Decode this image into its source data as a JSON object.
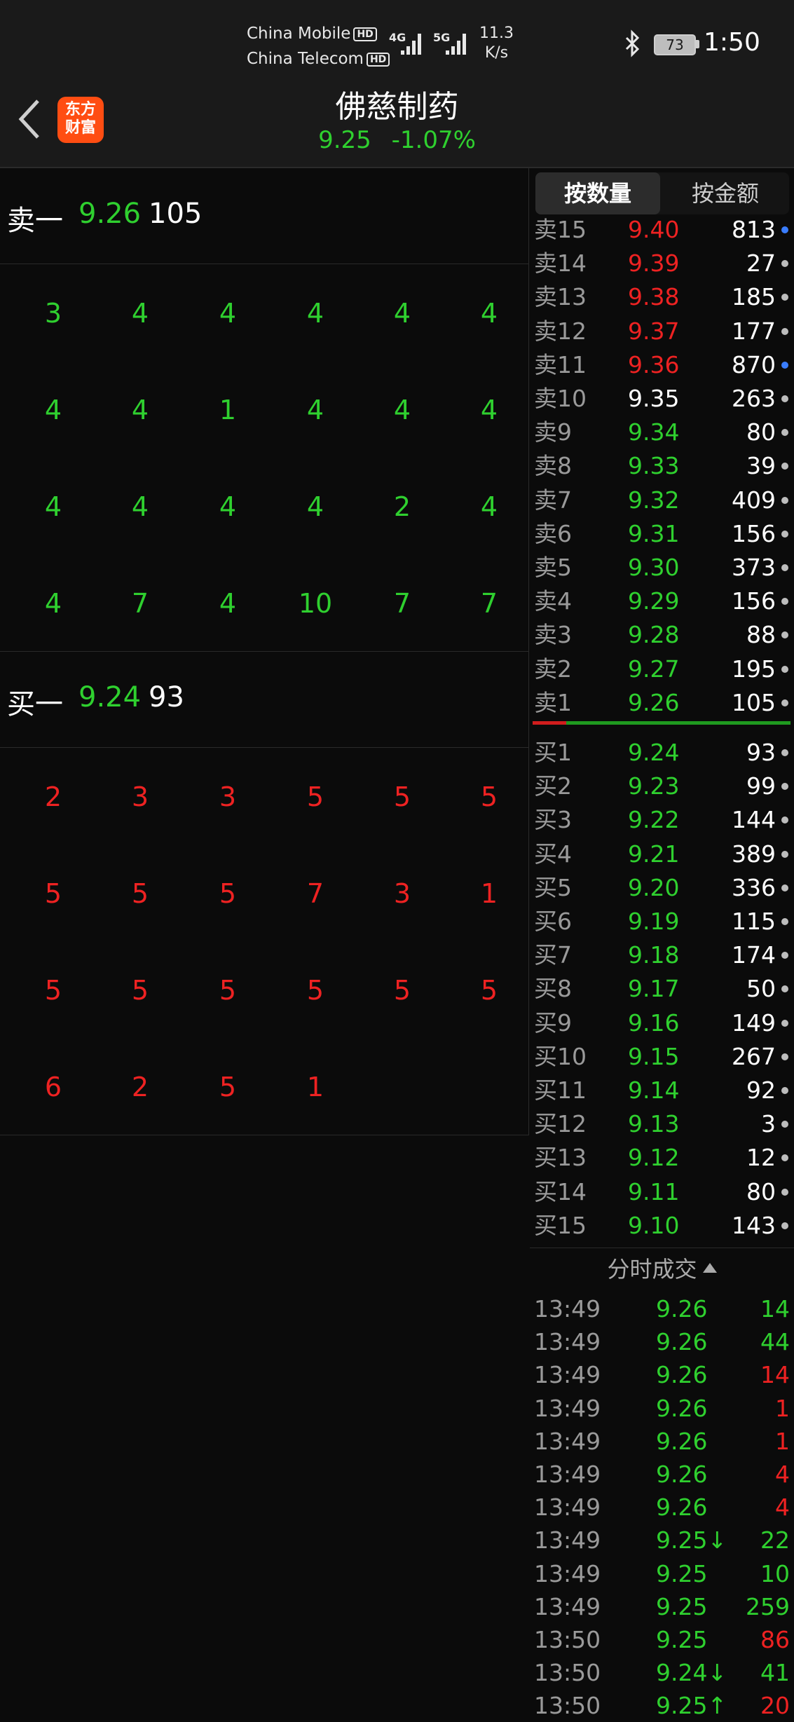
{
  "status_bar": {
    "carrier1": "China Mobile",
    "carrier2": "China Telecom",
    "hd_badge": "HD",
    "sig1_label": "4G",
    "sig2_label": "5G",
    "net_speed_value": "11.3",
    "net_speed_unit": "K/s",
    "battery": "73",
    "time": "1:50"
  },
  "header": {
    "logo_line1": "东方",
    "logo_line2": "财富",
    "stock_name": "佛慈制药",
    "price": "9.25",
    "change": "-1.07%"
  },
  "level1": {
    "sell_label": "卖一",
    "sell_price": "9.26",
    "sell_volume": "105",
    "buy_label": "买一",
    "buy_price": "9.24",
    "buy_volume": "93"
  },
  "sell_queue": [
    [
      "3",
      "4",
      "4",
      "4",
      "4",
      "4"
    ],
    [
      "4",
      "4",
      "1",
      "4",
      "4",
      "4"
    ],
    [
      "4",
      "4",
      "4",
      "4",
      "2",
      "4"
    ],
    [
      "4",
      "7",
      "4",
      "10",
      "7",
      "7"
    ]
  ],
  "buy_queue": [
    [
      "2",
      "3",
      "3",
      "5",
      "5",
      "5"
    ],
    [
      "5",
      "5",
      "5",
      "7",
      "3",
      "1"
    ],
    [
      "5",
      "5",
      "5",
      "5",
      "5",
      "5"
    ],
    [
      "6",
      "2",
      "5",
      "1",
      "",
      ""
    ]
  ],
  "tabs": {
    "by_volume": "按数量",
    "by_amount": "按金额"
  },
  "order_book": {
    "asks": [
      {
        "label": "卖15",
        "price": "9.40",
        "volume": "813",
        "color": "red",
        "dot": "blue"
      },
      {
        "label": "卖14",
        "price": "9.39",
        "volume": "27",
        "color": "red",
        "dot": "grey"
      },
      {
        "label": "卖13",
        "price": "9.38",
        "volume": "185",
        "color": "red",
        "dot": "grey"
      },
      {
        "label": "卖12",
        "price": "9.37",
        "volume": "177",
        "color": "red",
        "dot": "grey"
      },
      {
        "label": "卖11",
        "price": "9.36",
        "volume": "870",
        "color": "red",
        "dot": "blue"
      },
      {
        "label": "卖10",
        "price": "9.35",
        "volume": "263",
        "color": "white",
        "dot": "grey"
      },
      {
        "label": "卖9",
        "price": "9.34",
        "volume": "80",
        "color": "green",
        "dot": "grey"
      },
      {
        "label": "卖8",
        "price": "9.33",
        "volume": "39",
        "color": "green",
        "dot": "grey"
      },
      {
        "label": "卖7",
        "price": "9.32",
        "volume": "409",
        "color": "green",
        "dot": "grey"
      },
      {
        "label": "卖6",
        "price": "9.31",
        "volume": "156",
        "color": "green",
        "dot": "grey"
      },
      {
        "label": "卖5",
        "price": "9.30",
        "volume": "373",
        "color": "green",
        "dot": "grey"
      },
      {
        "label": "卖4",
        "price": "9.29",
        "volume": "156",
        "color": "green",
        "dot": "grey"
      },
      {
        "label": "卖3",
        "price": "9.28",
        "volume": "88",
        "color": "green",
        "dot": "grey"
      },
      {
        "label": "卖2",
        "price": "9.27",
        "volume": "195",
        "color": "green",
        "dot": "grey"
      },
      {
        "label": "卖1",
        "price": "9.26",
        "volume": "105",
        "color": "green",
        "dot": "grey"
      }
    ],
    "bids": [
      {
        "label": "买1",
        "price": "9.24",
        "volume": "93",
        "color": "green",
        "dot": "grey"
      },
      {
        "label": "买2",
        "price": "9.23",
        "volume": "99",
        "color": "green",
        "dot": "grey"
      },
      {
        "label": "买3",
        "price": "9.22",
        "volume": "144",
        "color": "green",
        "dot": "grey"
      },
      {
        "label": "买4",
        "price": "9.21",
        "volume": "389",
        "color": "green",
        "dot": "grey"
      },
      {
        "label": "买5",
        "price": "9.20",
        "volume": "336",
        "color": "green",
        "dot": "grey"
      },
      {
        "label": "买6",
        "price": "9.19",
        "volume": "115",
        "color": "green",
        "dot": "grey"
      },
      {
        "label": "买7",
        "price": "9.18",
        "volume": "174",
        "color": "green",
        "dot": "grey"
      },
      {
        "label": "买8",
        "price": "9.17",
        "volume": "50",
        "color": "green",
        "dot": "grey"
      },
      {
        "label": "买9",
        "price": "9.16",
        "volume": "149",
        "color": "green",
        "dot": "grey"
      },
      {
        "label": "买10",
        "price": "9.15",
        "volume": "267",
        "color": "green",
        "dot": "grey"
      },
      {
        "label": "买11",
        "price": "9.14",
        "volume": "92",
        "color": "green",
        "dot": "grey"
      },
      {
        "label": "买12",
        "price": "9.13",
        "volume": "3",
        "color": "green",
        "dot": "grey"
      },
      {
        "label": "买13",
        "price": "9.12",
        "volume": "12",
        "color": "green",
        "dot": "grey"
      },
      {
        "label": "买14",
        "price": "9.11",
        "volume": "80",
        "color": "green",
        "dot": "grey"
      },
      {
        "label": "买15",
        "price": "9.10",
        "volume": "143",
        "color": "green",
        "dot": "grey"
      }
    ]
  },
  "ticks_header": "分时成交",
  "ticks": [
    {
      "time": "13:49",
      "price": "9.26",
      "price_color": "green",
      "volume": "14",
      "volume_color": "green"
    },
    {
      "time": "13:49",
      "price": "9.26",
      "price_color": "green",
      "volume": "44",
      "volume_color": "green"
    },
    {
      "time": "13:49",
      "price": "9.26",
      "price_color": "green",
      "volume": "14",
      "volume_color": "red"
    },
    {
      "time": "13:49",
      "price": "9.26",
      "price_color": "green",
      "volume": "1",
      "volume_color": "red"
    },
    {
      "time": "13:49",
      "price": "9.26",
      "price_color": "green",
      "volume": "1",
      "volume_color": "red"
    },
    {
      "time": "13:49",
      "price": "9.26",
      "price_color": "green",
      "volume": "4",
      "volume_color": "red"
    },
    {
      "time": "13:49",
      "price": "9.26",
      "price_color": "green",
      "volume": "4",
      "volume_color": "red"
    },
    {
      "time": "13:49",
      "price": "9.25↓",
      "price_color": "green",
      "volume": "22",
      "volume_color": "green"
    },
    {
      "time": "13:49",
      "price": "9.25",
      "price_color": "green",
      "volume": "10",
      "volume_color": "green"
    },
    {
      "time": "13:49",
      "price": "9.25",
      "price_color": "green",
      "volume": "259",
      "volume_color": "green"
    },
    {
      "time": "13:50",
      "price": "9.25",
      "price_color": "green",
      "volume": "86",
      "volume_color": "red"
    },
    {
      "time": "13:50",
      "price": "9.24↓",
      "price_color": "green",
      "volume": "41",
      "volume_color": "green"
    },
    {
      "time": "13:50",
      "price": "9.25↑",
      "price_color": "green",
      "volume": "20",
      "volume_color": "red"
    }
  ],
  "colors": {
    "up": "#ee2222",
    "down": "#2fd02f",
    "neutral": "#ffffff"
  }
}
